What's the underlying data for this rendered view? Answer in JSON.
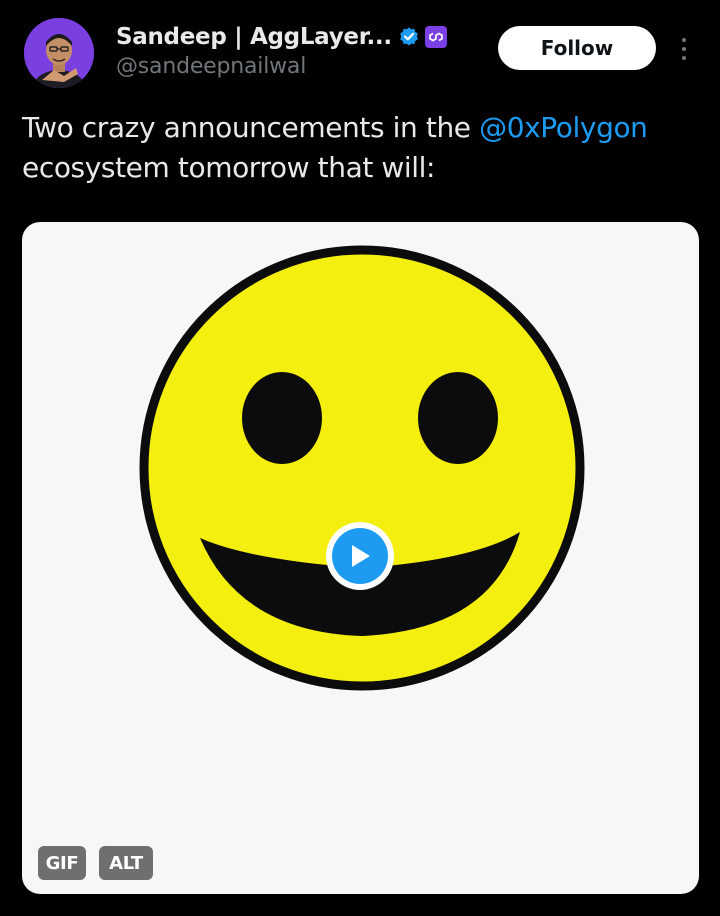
{
  "author": {
    "display_name": "Sandeep | AggLayer...",
    "handle": "@sandeepnailwal",
    "avatar_icon": "profile-photo",
    "verified_icon": "verified-badge-icon",
    "affiliate_icon": "polygon-affiliate-icon"
  },
  "actions": {
    "follow_label": "Follow",
    "more_icon": "more-vertical-icon"
  },
  "tweet": {
    "text_before": "Two crazy announcements in the ",
    "mention": "@0xPolygon",
    "text_after": " ecosystem tomorrow that will:"
  },
  "media": {
    "image": "yellow-smiley-face",
    "play_icon": "play-icon",
    "gif_label": "GIF",
    "alt_label": "ALT"
  },
  "colors": {
    "background": "#000000",
    "text": "#e7e9ea",
    "secondary_text": "#71767b",
    "accent": "#1d9bf0",
    "affiliate": "#7b3fe4",
    "smiley_yellow": "#f5ef0f"
  }
}
